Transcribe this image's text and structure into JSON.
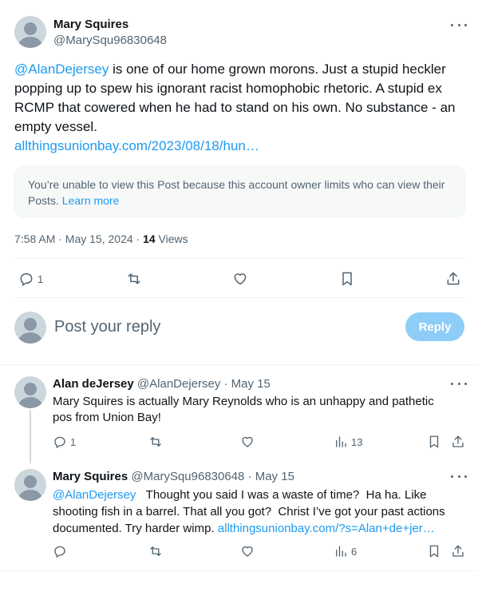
{
  "main_tweet": {
    "author_name": "Mary Squires",
    "author_handle": "@MarySqu96830648",
    "mention": "@AlanDejersey",
    "text_after_mention": " is one of our home grown morons. Just a stupid heckler popping up to spew his ignorant racist homophobic rhetoric. A stupid ex RCMP that cowered when he had to stand on his own. No substance - an empty vessel.",
    "link": "allthingsunionbay.com/2023/08/18/hun…",
    "notice_text": "You’re unable to view this Post because this account owner limits who can view their Posts.",
    "notice_link": "Learn more",
    "timestamp": "7:58 AM · May 15, 2024 · ",
    "views_count": "14",
    "views_label": " Views",
    "reply_count": "1"
  },
  "reply_box": {
    "placeholder": "Post your reply",
    "button_label": "Reply"
  },
  "replies": [
    {
      "author_name": "Alan deJersey",
      "author_handle": "@AlanDejersey",
      "date": " · May 15",
      "text": "Mary Squires is actually Mary Reynolds who is an unhappy and pathetic pos from Union Bay!",
      "reply_count": "1",
      "views_count": "13"
    },
    {
      "author_name": "Mary Squires",
      "author_handle": "@MarySqu96830648",
      "date": " · May 15",
      "mention": "@AlanDejersey",
      "text": "   Thought you said I was a waste of time?  Ha ha. Like shooting fish in a barrel. That all you got?  Christ I’ve got your past actions documented. Try harder wimp. ",
      "link": "allthingsunionbay.com/?s=Alan+de+jer…",
      "views_count": "6"
    }
  ],
  "icons": [
    "more-icon",
    "reply-icon",
    "retweet-icon",
    "like-icon",
    "bookmark-icon",
    "share-icon",
    "views-icon",
    "avatar"
  ],
  "colors": {
    "link": "#1d9bf0",
    "reply_button": "#8ecdf8",
    "muted": "#536471"
  }
}
